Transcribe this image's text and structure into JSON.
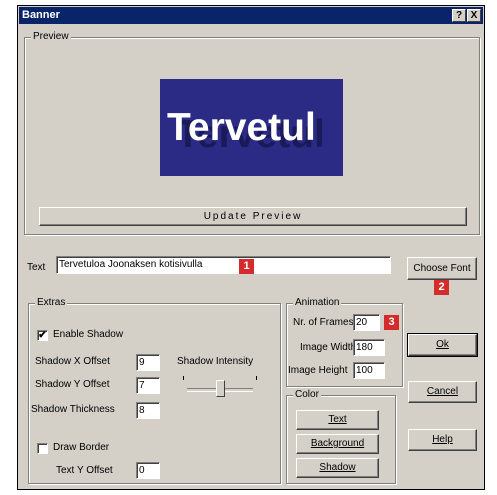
{
  "window": {
    "title": "Banner",
    "help_btn": "?",
    "close_btn": "X"
  },
  "preview": {
    "legend": "Preview",
    "banner_text": "Tervetul",
    "update_button": "Update Preview"
  },
  "text_row": {
    "label": "Text",
    "value": "Tervetuloa Joonaksen kotisivulla",
    "choose_font": "Choose Font"
  },
  "extras": {
    "legend": "Extras",
    "enable_shadow": {
      "label": "Enable Shadow",
      "checked": true,
      "mark": "✔"
    },
    "shadow_x": {
      "label": "Shadow X Offset",
      "value": "9"
    },
    "shadow_y": {
      "label": "Shadow Y Offset",
      "value": "7"
    },
    "shadow_thickness": {
      "label": "Shadow Thickness",
      "value": "8"
    },
    "shadow_intensity": {
      "label": "Shadow Intensity",
      "level": 0.5
    },
    "draw_border": {
      "label": "Draw Border",
      "checked": false
    },
    "text_y": {
      "label": "Text Y Offset",
      "value": "0"
    }
  },
  "animation": {
    "legend": "Animation",
    "frames": {
      "label": "Nr. of Frames",
      "value": "20"
    },
    "width": {
      "label": "Image Width",
      "value": "180"
    },
    "height": {
      "label": "Image Height",
      "value": "100"
    }
  },
  "color": {
    "legend": "Color",
    "text_btn": "Text",
    "background_btn": "Background",
    "shadow_btn": "Shadow"
  },
  "buttons": {
    "ok": "Ok",
    "cancel": "Cancel",
    "help": "Help"
  },
  "badges": {
    "one": "1",
    "two": "2",
    "three": "3"
  },
  "colors": {
    "banner_bg": "#2b2b85",
    "banner_text": "#ffffff",
    "badge": "#d42b2b",
    "titlebar": "#0a246a"
  }
}
